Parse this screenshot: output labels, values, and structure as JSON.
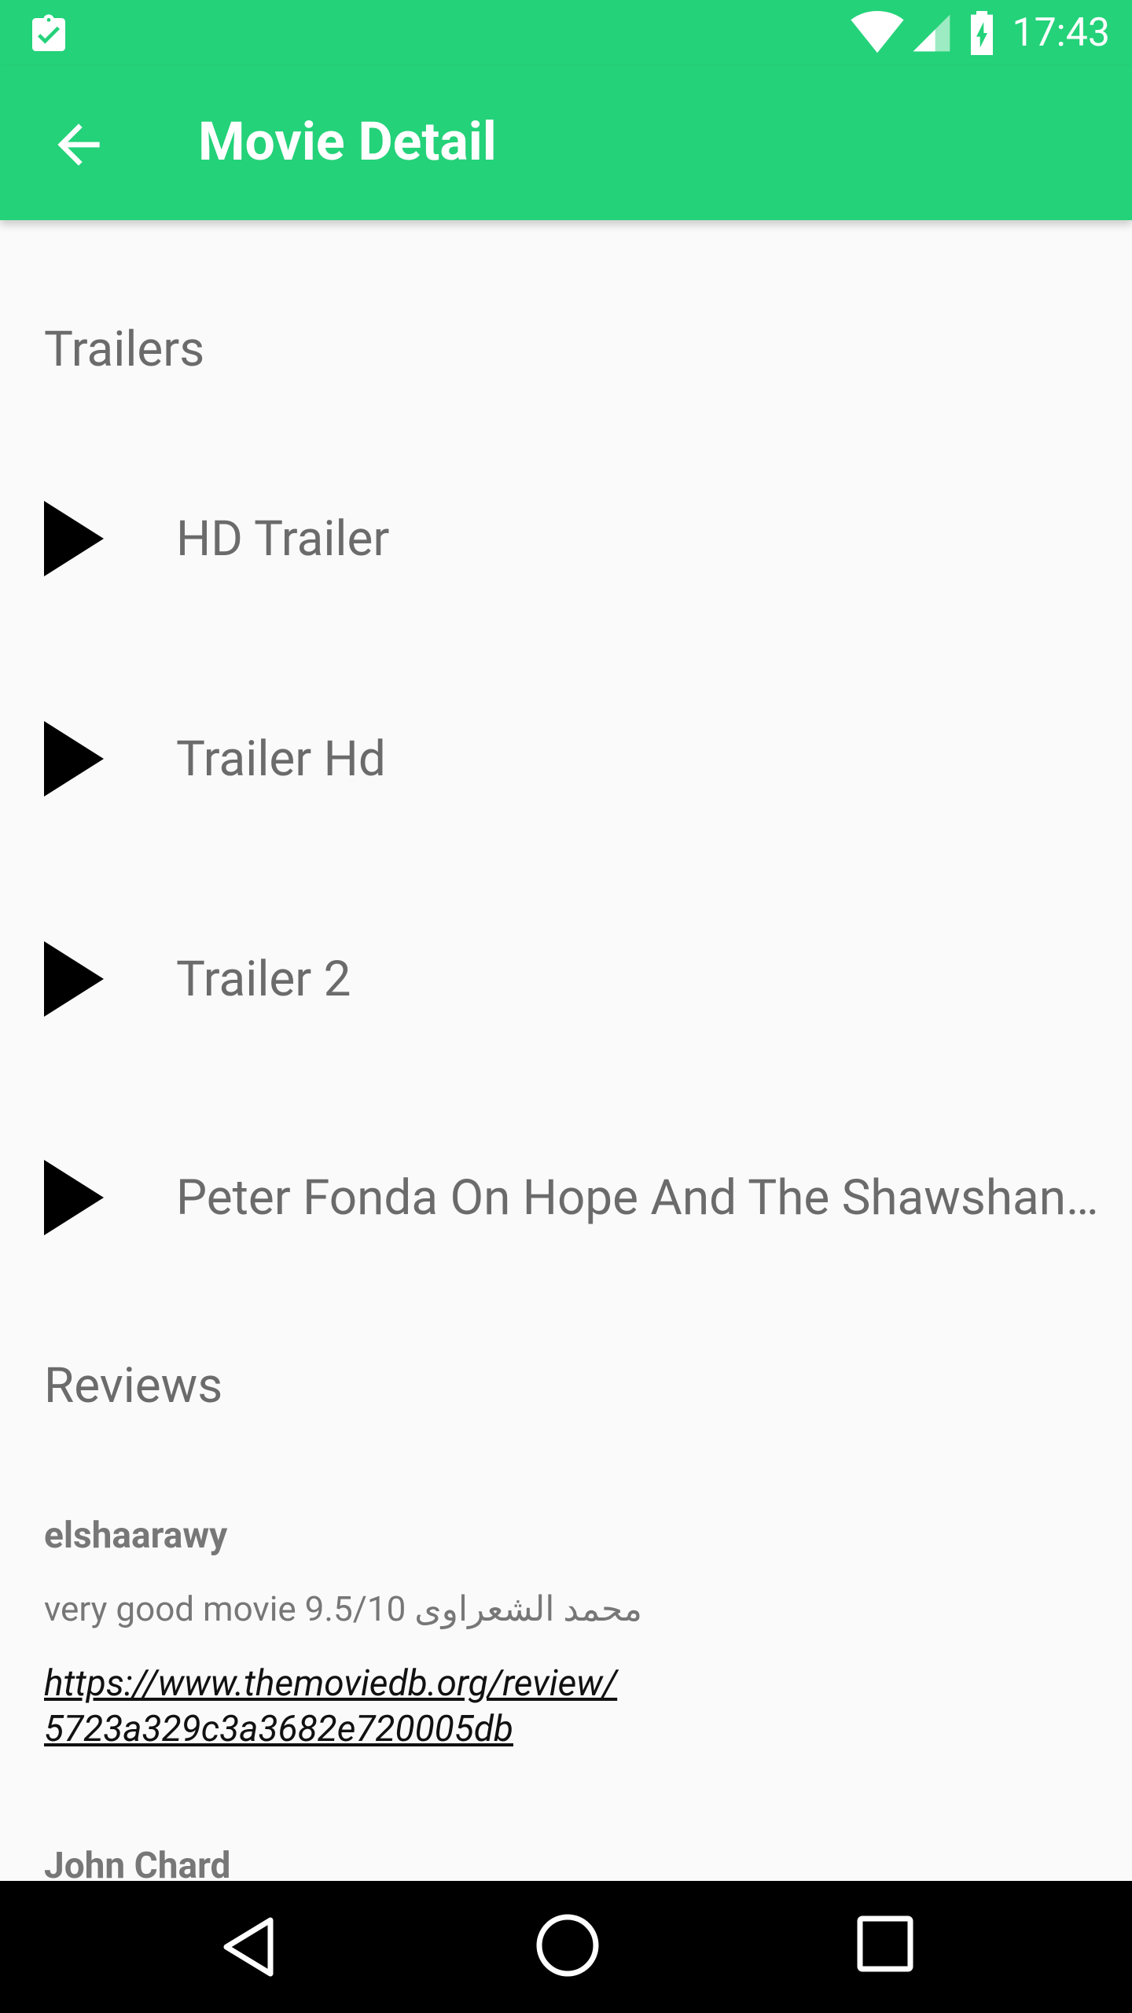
{
  "status_bar": {
    "time": "17:43",
    "icons": [
      "clipboard-check-icon",
      "wifi-icon",
      "signal-icon",
      "battery-charging-icon"
    ]
  },
  "app_bar": {
    "title": "Movie Detail",
    "back_icon": "arrow-back-icon"
  },
  "trailers": {
    "heading": "Trailers",
    "items": [
      {
        "label": "HD Trailer",
        "icon": "play-icon"
      },
      {
        "label": "Trailer Hd",
        "icon": "play-icon"
      },
      {
        "label": "Trailer 2",
        "icon": "play-icon"
      },
      {
        "label": "Peter Fonda On Hope And The Shawshank Redemption",
        "icon": "play-icon"
      }
    ]
  },
  "reviews": {
    "heading": "Reviews",
    "items": [
      {
        "author": "elshaarawy",
        "content": "very good movie 9.5/10 محمد الشعراوى",
        "link": "https://www.themoviedb.org/review/5723a329c3a3682e720005db",
        "link_line1": "https://www.themoviedb.org/review/",
        "link_line2": "5723a329c3a3682e720005db"
      },
      {
        "author": "John Chard"
      }
    ]
  },
  "nav_bar": {
    "back": "nav-back-icon",
    "home": "nav-home-icon",
    "recents": "nav-recents-icon"
  },
  "colors": {
    "primary": "#24d279",
    "background": "#fafafa",
    "text_secondary": "#6b6b6b",
    "nav_bar": "#000000"
  }
}
